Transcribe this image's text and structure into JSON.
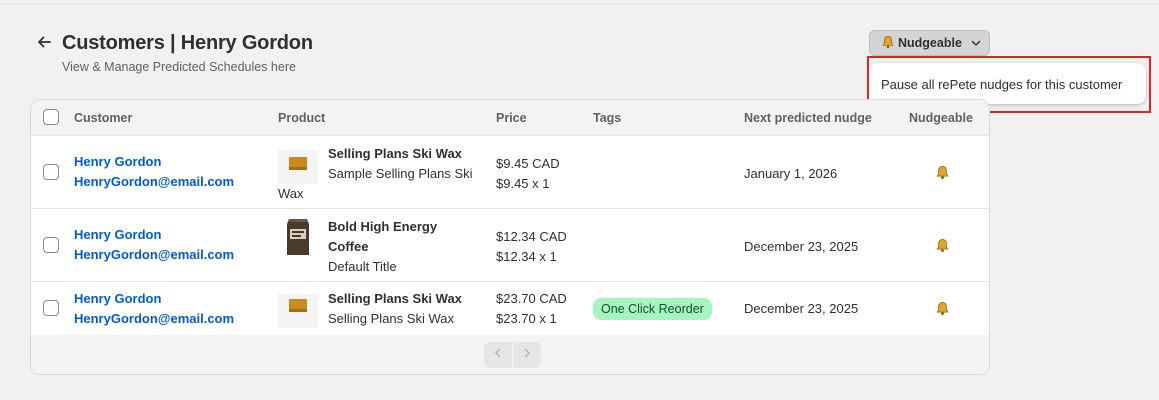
{
  "header": {
    "title": "Customers | Henry Gordon",
    "subtitle": "View & Manage Predicted Schedules here",
    "back_icon": "arrow-left-icon"
  },
  "nudge_dropdown": {
    "label": "Nudgeable",
    "icon": "bell-icon",
    "chevron_icon": "chevron-down-icon"
  },
  "popover": {
    "item_label": "Pause all rePete nudges for this customer",
    "highlight_color": "#e02424"
  },
  "table": {
    "columns": [
      "Customer",
      "Product",
      "Price",
      "Tags",
      "Next predicted nudge",
      "Nudgeable"
    ],
    "rows": [
      {
        "customer_name": "Henry Gordon",
        "customer_email": "HenryGordon@email.com",
        "product_name": "Selling Plans Ski Wax",
        "product_variant_1": "Sample Selling Plans Ski",
        "product_variant_2": "Wax",
        "price": "$9.45 CAD",
        "price_qty": "$9.45 x 1",
        "tag": "",
        "next_nudge": "January 1, 2026",
        "nudgeable_icon": "bell-icon",
        "thumbnail": "ski-wax-thumbnail"
      },
      {
        "customer_name": "Henry Gordon",
        "customer_email": "HenryGordon@email.com",
        "product_name_1": "Bold High Energy",
        "product_name_2": "Coffee",
        "product_variant": "Default Title",
        "price": "$12.34 CAD",
        "price_qty": "$12.34 x 1",
        "tag": "",
        "next_nudge": "December 23, 2025",
        "nudgeable_icon": "bell-icon",
        "thumbnail": "coffee-bag-thumbnail"
      },
      {
        "customer_name": "Henry Gordon",
        "customer_email": "HenryGordon@email.com",
        "product_name": "Selling Plans Ski Wax",
        "product_variant": "Selling Plans Ski Wax",
        "price": "$23.70 CAD",
        "price_qty": "$23.70 x 1",
        "tag": "One Click Reorder",
        "next_nudge": "December 23, 2025",
        "nudgeable_icon": "bell-icon",
        "thumbnail": "ski-wax-thumbnail"
      }
    ]
  },
  "pagination": {
    "prev_icon": "chevron-left-icon",
    "next_icon": "chevron-right-icon"
  },
  "colors": {
    "link": "#005bd3",
    "tag_bg": "#a8f4bf",
    "bell": "#e0a526"
  }
}
